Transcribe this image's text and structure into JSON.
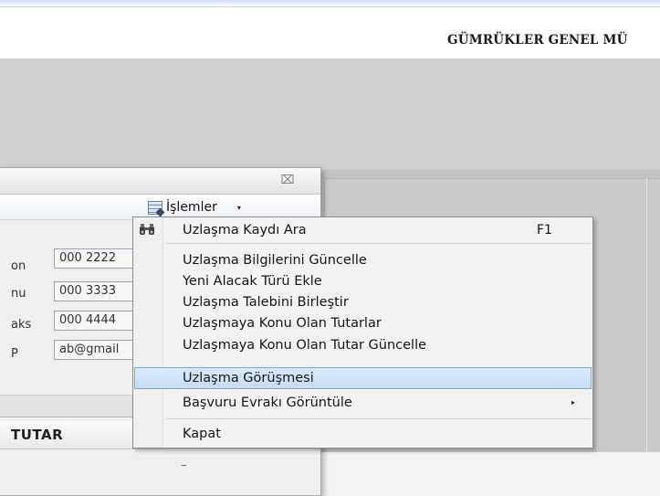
{
  "app": {
    "header_title": "GÜMRÜKLER GENEL MÜ"
  },
  "dialog": {
    "close_glyph": "⌧",
    "toolbar": {
      "menu_button_label": "İşlemler",
      "dropdown_glyph": "▾"
    },
    "fields": [
      {
        "label": "on",
        "value": "000 2222"
      },
      {
        "label": "nu",
        "value": "000 3333"
      },
      {
        "label": "aks",
        "value": "000 4444"
      },
      {
        "label": "P",
        "value": "ab@gmail"
      }
    ],
    "table": {
      "header": "TUTAR",
      "cell_placeholder": "–"
    }
  },
  "menu": {
    "items": [
      {
        "label": "Uzlaşma Kaydı Ara",
        "shortcut": "F1",
        "icon": "binoculars-icon"
      },
      {
        "label": "Uzlaşma Bilgilerini Güncelle"
      },
      {
        "label": "Yeni Alacak Türü Ekle"
      },
      {
        "label": "Uzlaşma Talebini Birleştir"
      },
      {
        "label": "Uzlaşmaya Konu Olan Tutarlar"
      },
      {
        "label": "Uzlaşmaya Konu Olan Tutar Güncelle"
      },
      {
        "label": "Uzlaşma Görüşmesi",
        "highlighted": true
      },
      {
        "label": "Başvuru Evrakı Görüntüle",
        "submenu_glyph": "▸"
      },
      {
        "label": "Kapat"
      }
    ]
  },
  "colors": {
    "highlight_bg": "#cfe2f8",
    "highlight_border": "#7fa8d6",
    "workspace_gray": "#c4c4c4"
  }
}
